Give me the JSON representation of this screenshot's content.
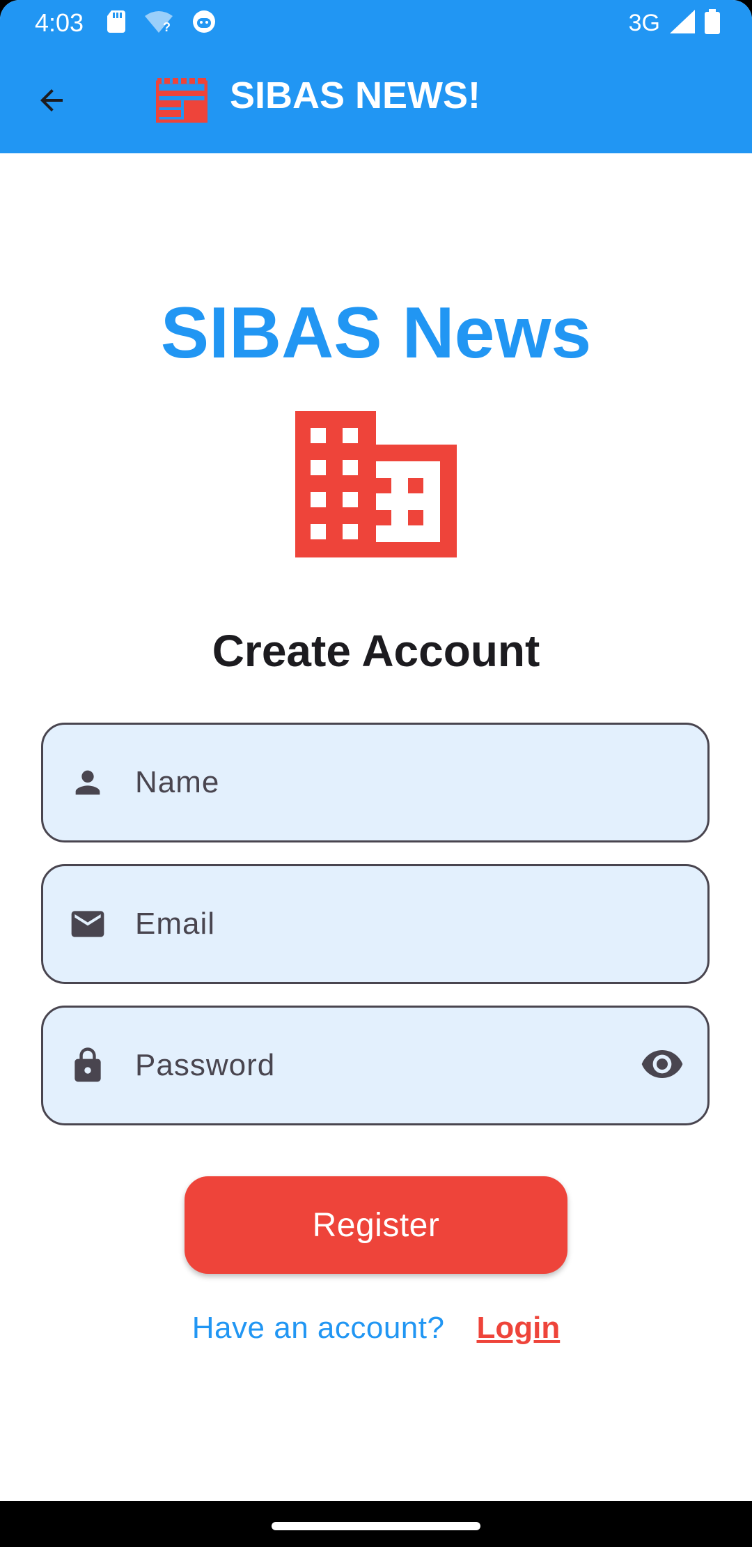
{
  "status_bar": {
    "time": "4:03",
    "network": "3G",
    "icons": [
      "sd-card-icon",
      "wifi-unknown-icon",
      "android-debug-icon",
      "signal-icon",
      "battery-icon"
    ]
  },
  "app_bar": {
    "title": "SIBAS NEWS!",
    "back_icon": "arrow-back-icon",
    "logo_icon": "newspaper-icon"
  },
  "main": {
    "brand_title": "SIBAS News",
    "brand_icon": "building-icon",
    "heading": "Create Account",
    "fields": {
      "name": {
        "placeholder": "Name",
        "value": "",
        "icon": "person-icon"
      },
      "email": {
        "placeholder": "Email",
        "value": "",
        "icon": "mail-icon"
      },
      "password": {
        "placeholder": "Password",
        "value": "",
        "icon": "lock-icon",
        "toggle_icon": "eye-icon"
      }
    },
    "register_label": "Register",
    "have_account_text": "Have an account?",
    "login_label": "Login"
  },
  "colors": {
    "primary": "#2196f3",
    "accent": "#ee443a",
    "field_fill": "#e3f0fd",
    "field_border": "#49454f",
    "text_dark": "#1c1b1f"
  }
}
